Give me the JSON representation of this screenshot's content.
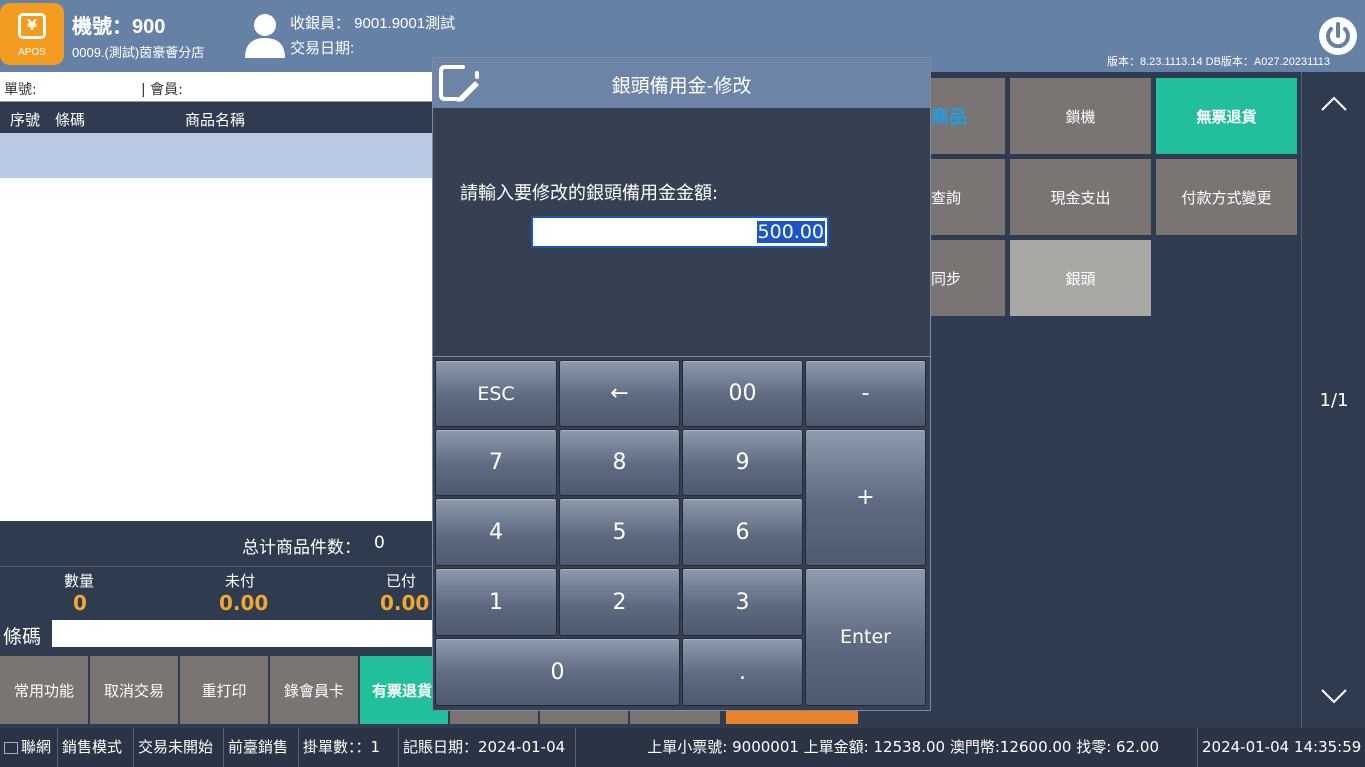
{
  "header": {
    "machine_label": "機號：900",
    "store_name": "0009.(測試)茵豪薈分店",
    "cashier": "收銀員： 9001.9001測試",
    "trade_date": "交易日期:",
    "version": "版本：8.23.1113.14 DB版本：A027.20231113",
    "logo_text": "APOS",
    "logo_symbol": "¥"
  },
  "order": {
    "order_no_label": "單號:",
    "member_label": "| 會員:",
    "columns": [
      "序號",
      "條碼",
      "商品名稱"
    ],
    "total_items_label": "总计商品件数：",
    "total_items_value": "0"
  },
  "summary": {
    "qty_label": "數量",
    "qty_value": "0",
    "unpaid_label": "未付",
    "unpaid_value": "0.00",
    "paid_label": "已付",
    "paid_value": "0.00"
  },
  "barcode": {
    "label": "條碼",
    "value": ""
  },
  "bottom_buttons": [
    "常用功能",
    "取消交易",
    "重打印",
    "錄會員卡",
    "有票退貨"
  ],
  "right_buttons": {
    "goods": "商品",
    "lock": "鎖機",
    "no_receipt_return": "無票退貨",
    "query": "查詢",
    "cash_out": "現金支出",
    "payment_change": "付款方式變更",
    "sync": "同步",
    "float": "銀頭"
  },
  "pager": {
    "page": "1/1",
    "up_icon": "chevron-up-icon",
    "down_icon": "chevron-down-icon"
  },
  "modal": {
    "title": "銀頭備用金-修改",
    "prompt": "請輸入要修改的銀頭備用金金額:",
    "amount_value": "500.00",
    "keys": {
      "esc": "ESC",
      "back": "←",
      "double_zero": "00",
      "minus": "-",
      "k7": "7",
      "k8": "8",
      "k9": "9",
      "plus": "+",
      "k4": "4",
      "k5": "5",
      "k6": "6",
      "k1": "1",
      "k2": "2",
      "k3": "3",
      "enter": "Enter",
      "k0": "0",
      "dot": "."
    }
  },
  "status": {
    "network": "聯網",
    "mode": "銷售模式",
    "trade_state": "交易未開始",
    "front_sale": "前臺銷售",
    "hold_count": "掛單數：：1",
    "posting_date": "記賬日期：2024-01-04",
    "last_receipt": "上單小票號: 9000001 上單金額: 12538.00  澳門幣:12600.00 找零: 62.00",
    "datetime": "2024-01-04 14:35:59"
  },
  "colors": {
    "header_bg": "#6681a6",
    "accent_orange": "#f39c1f",
    "accent_green": "#22bf9c",
    "value_gold": "#f0a830",
    "button_grey": "#7a7472"
  }
}
